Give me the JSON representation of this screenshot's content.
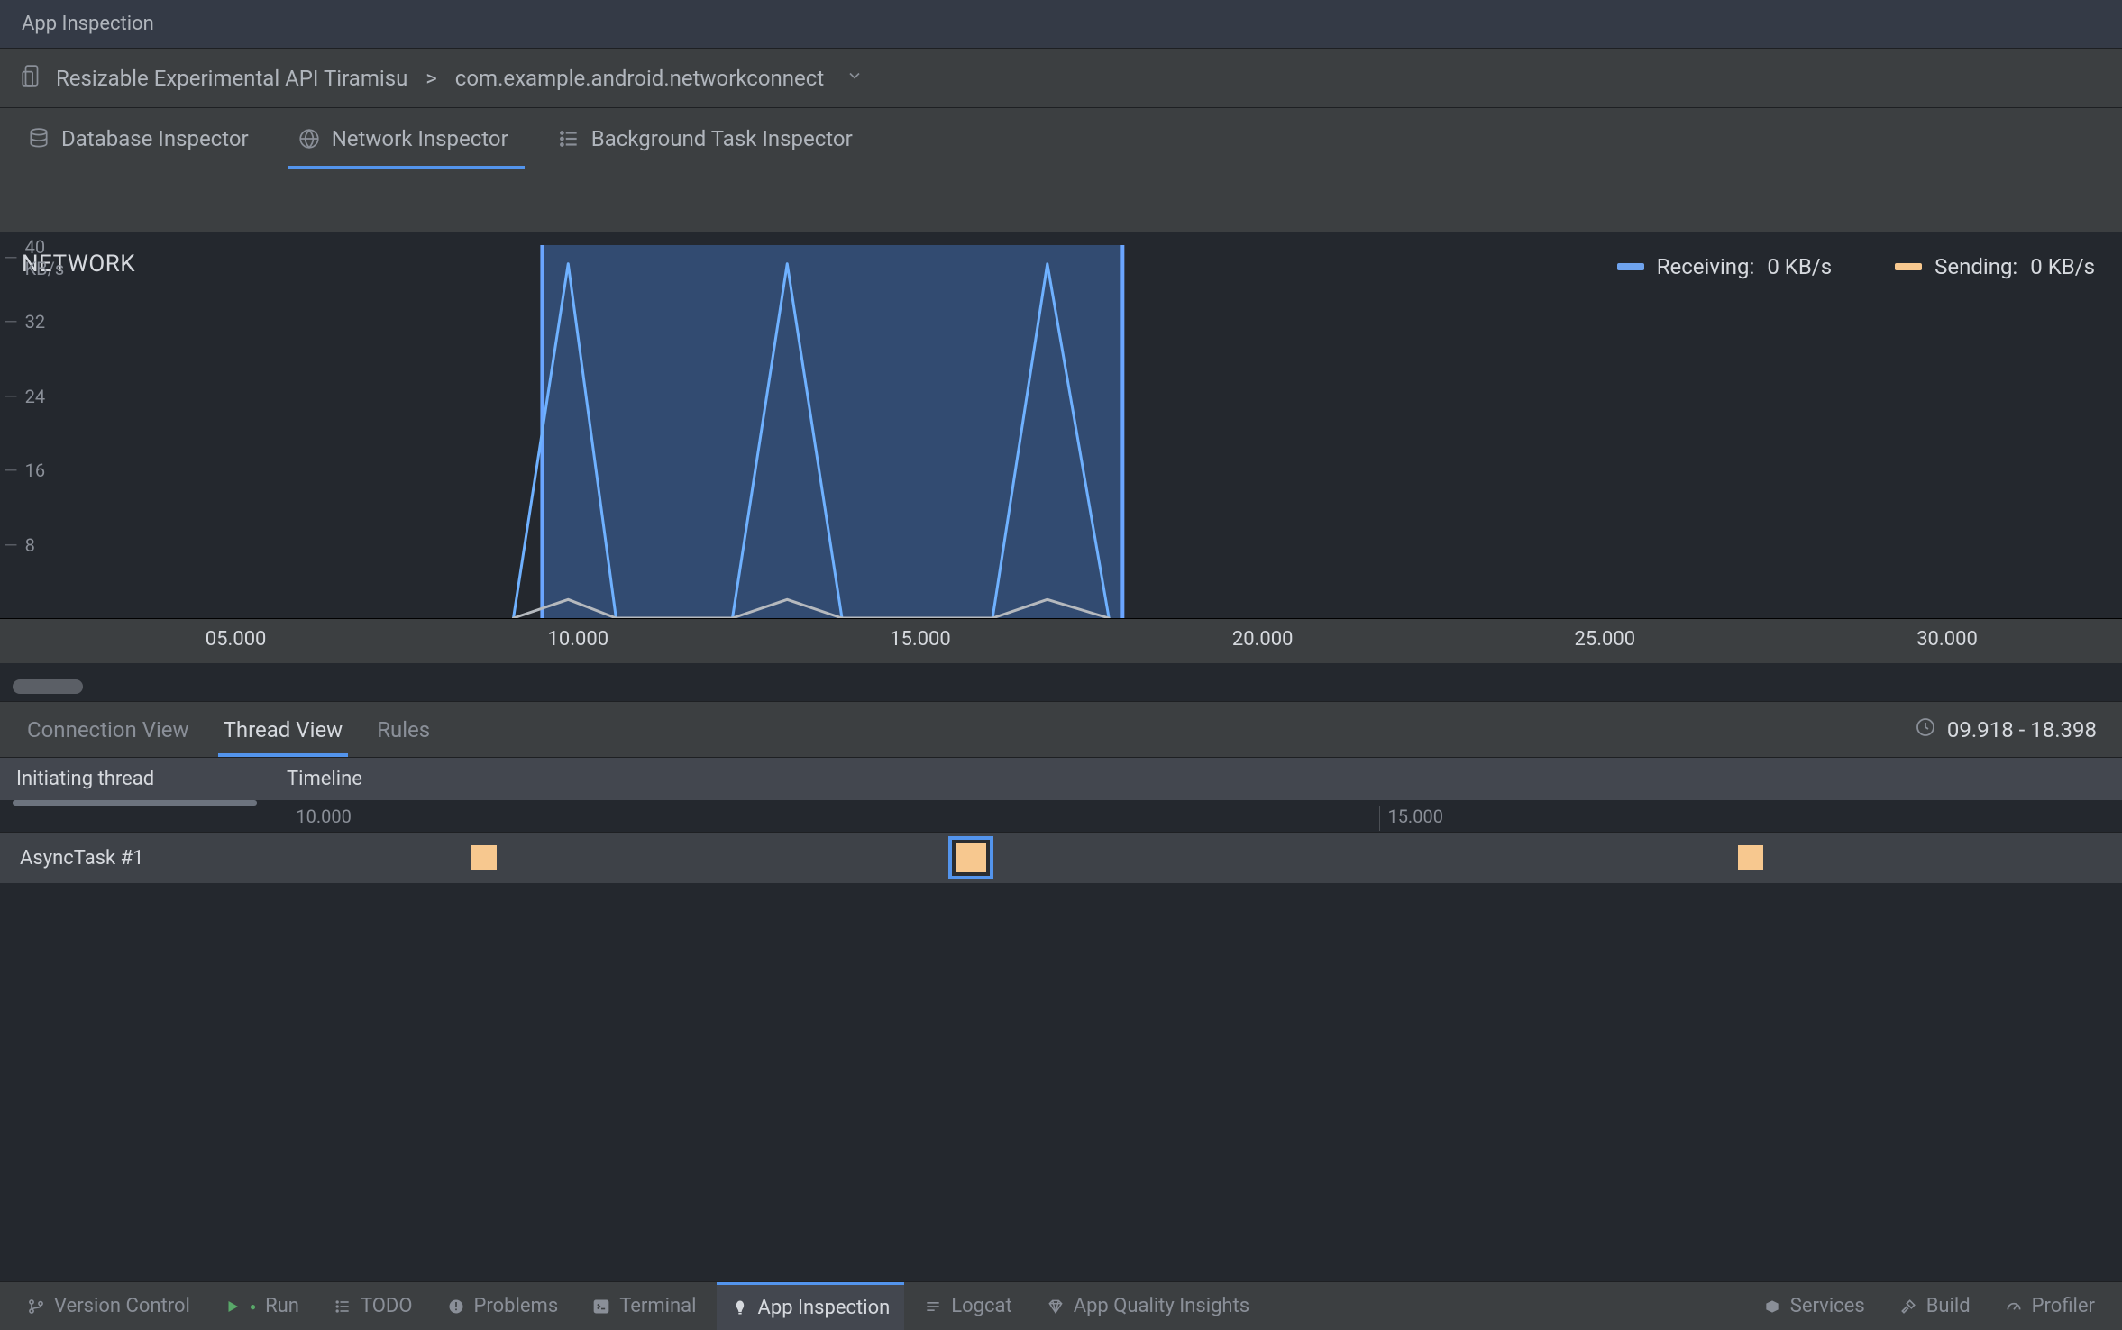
{
  "title": "App Inspection",
  "target": {
    "device": "Resizable Experimental API Tiramisu",
    "process": "com.example.android.networkconnect"
  },
  "inspector_tabs": {
    "database": "Database Inspector",
    "network": "Network Inspector",
    "background": "Background Task Inspector",
    "active": "network"
  },
  "chart_data": {
    "type": "line",
    "title": "NETWORK",
    "ylabel": "KB/s",
    "ylim": [
      0,
      40
    ],
    "y_ticks": [
      "40 KB/s",
      "32",
      "24",
      "16",
      "8"
    ],
    "xlim": [
      2,
      33
    ],
    "x_ticks": [
      "05.000",
      "10.000",
      "15.000",
      "20.000",
      "25.000",
      "30.000"
    ],
    "x_tick_values": [
      5,
      10,
      15,
      20,
      25,
      30
    ],
    "selection": [
      9.92,
      18.4
    ],
    "series": [
      {
        "name": "Receiving",
        "color": "#6fb1ff",
        "x": [
          9.5,
          10.3,
          11.0,
          12.7,
          13.5,
          14.3,
          16.5,
          17.3,
          18.2
        ],
        "values": [
          0,
          38,
          0,
          0,
          38,
          0,
          0,
          38,
          0
        ]
      },
      {
        "name": "Sending",
        "color": "#b5b9be",
        "x": [
          9.5,
          10.3,
          11.0,
          12.7,
          13.5,
          14.3,
          16.5,
          17.3,
          18.2
        ],
        "values": [
          0,
          2,
          0,
          0,
          2,
          0,
          0,
          2,
          0
        ]
      }
    ],
    "legend": {
      "receiving": {
        "label": "Receiving:",
        "value": "0 KB/s"
      },
      "sending": {
        "label": "Sending:",
        "value": "0 KB/s"
      }
    }
  },
  "lower_tabs": {
    "connection": "Connection View",
    "thread": "Thread View",
    "rules": "Rules",
    "active": "thread"
  },
  "time_range": "09.918 - 18.398",
  "grid": {
    "lead_header": "Initiating thread",
    "timeline_header": "Timeline",
    "sub_ticks": [
      {
        "label": "10.000",
        "value": 10.0
      },
      {
        "label": "15.000",
        "value": 15.0
      }
    ],
    "rows": [
      {
        "name": "AsyncTask #1",
        "tasks": [
          {
            "t": 10.9,
            "selected": false
          },
          {
            "t": 13.1,
            "selected": true
          },
          {
            "t": 16.7,
            "selected": false
          }
        ]
      }
    ]
  },
  "bottom_bar": {
    "left": {
      "version_control": "Version Control",
      "run": "Run",
      "todo": "TODO",
      "problems": "Problems",
      "terminal": "Terminal",
      "app_inspection": "App Inspection",
      "logcat": "Logcat",
      "app_quality": "App Quality Insights"
    },
    "right": {
      "services": "Services",
      "build": "Build",
      "profiler": "Profiler"
    },
    "active": "app_inspection"
  }
}
